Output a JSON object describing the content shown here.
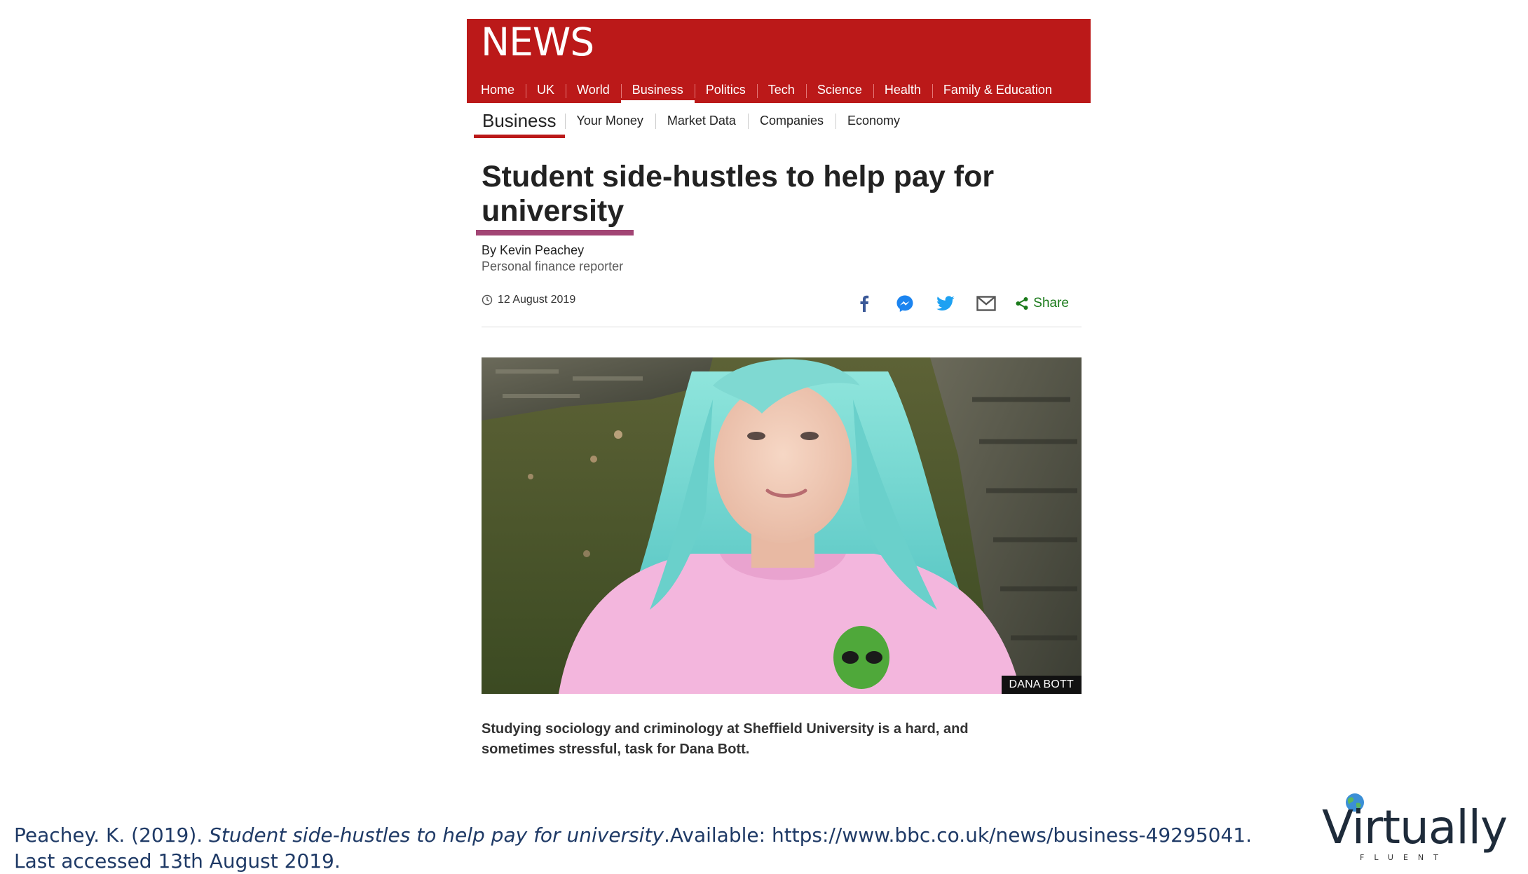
{
  "header": {
    "logo": "NEWS",
    "primary_nav": [
      "Home",
      "UK",
      "World",
      "Business",
      "Politics",
      "Tech",
      "Science",
      "Health",
      "Family & Education"
    ],
    "active_nav": "Business"
  },
  "secondary_nav": {
    "section": "Business",
    "items": [
      "Your Money",
      "Market Data",
      "Companies",
      "Economy"
    ]
  },
  "article": {
    "headline": "Student side-hustles to help pay for university",
    "author": "By Kevin Peachey",
    "author_title": "Personal finance reporter",
    "date": "12 August 2019",
    "share_icons": [
      "facebook-icon",
      "messenger-icon",
      "twitter-icon",
      "email-icon"
    ],
    "share_label": "Share",
    "image_credit": "DANA BOTT",
    "summary": "Studying sociology and criminology at Sheffield University is a hard, and sometimes stressful, task for Dana Bott."
  },
  "citation": {
    "prefix": "Peachey. K. (2019). ",
    "title": "Student side-hustles to help pay for university",
    "suffix": ".Available: https://www.bbc.co.uk/news/business-49295041. Last accessed 13th August 2019."
  },
  "brand": {
    "name": "Virtually",
    "tagline": "FLUENT"
  },
  "colors": {
    "bbc_red": "#bb1919",
    "headline_underline": "#a24574",
    "share_green": "#1a7a1a",
    "citation_navy": "#1f3a66"
  }
}
